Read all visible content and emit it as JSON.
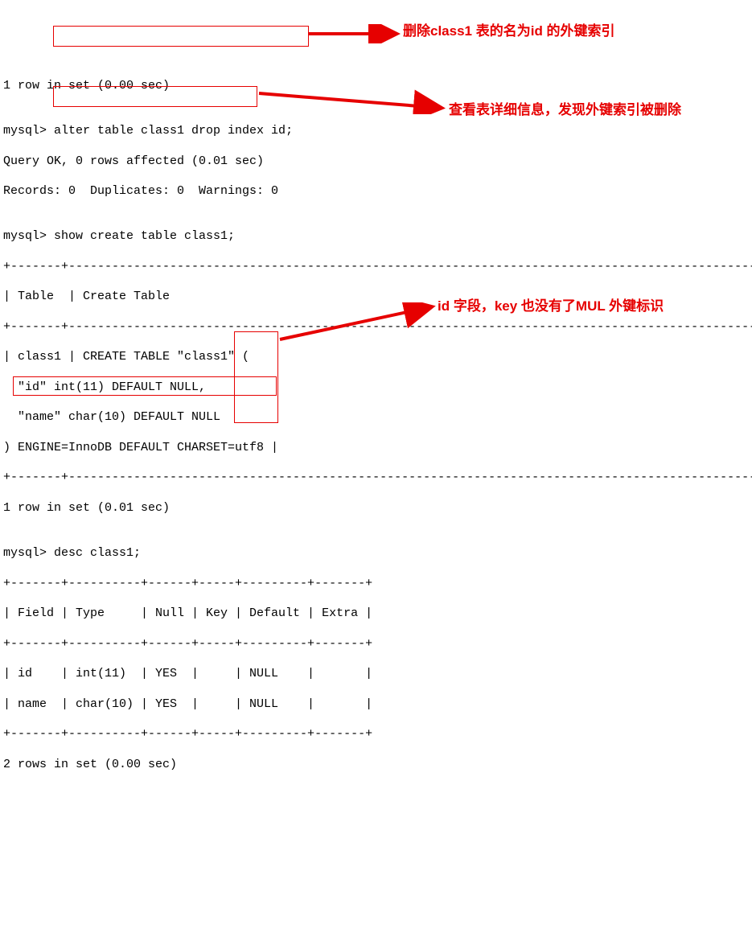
{
  "lines": {
    "l0": "1 row in set (0.00 sec)",
    "l1": "",
    "l2_prompt": "mysql> ",
    "l2_cmd": "alter table class1 drop index id;",
    "l3": "Query OK, 0 rows affected (0.01 sec)",
    "l4": "Records: 0  Duplicates: 0  Warnings: 0",
    "l5": "",
    "l6_prompt": "mysql> ",
    "l6_cmd": "show create table class1;",
    "l7": "+-------+---------------------------------------------------------------------------------------------------------",
    "l8": "| Table  | Create Table",
    "l9": "+-------+---------------------------------------------------------------------------------------------------------",
    "l10": "| class1 | CREATE TABLE \"class1\" (",
    "l11": "  \"id\" int(11) DEFAULT NULL,",
    "l12": "  \"name\" char(10) DEFAULT NULL",
    "l13": ") ENGINE=InnoDB DEFAULT CHARSET=utf8 |",
    "l14": "+-------+---------------------------------------------------------------------------------------------------------",
    "l15": "1 row in set (0.01 sec)",
    "l16": "",
    "l17_prompt": "mysql> ",
    "l17_cmd": "desc class1;",
    "l18": "+-------+----------+------+-----+---------+-------+",
    "l19": "| Field | Type     | Null | Key | Default | Extra |",
    "l20": "+-------+----------+------+-----+---------+-------+",
    "l21": "| id    | int(11)  | YES  |     | NULL    |       |",
    "l22": "| name  | char(10) | YES  |     | NULL    |       |",
    "l23": "+-------+----------+------+-----+---------+-------+",
    "l24": "2 rows in set (0.00 sec)"
  },
  "annotations": {
    "a1": "删除class1 表的名为id 的外键索引",
    "a2": "查看表详细信息，发现外键索引被删除",
    "a3": "id 字段，key 也没有了MUL 外键标识"
  },
  "desc_table": {
    "columns": [
      "Field",
      "Type",
      "Null",
      "Key",
      "Default",
      "Extra"
    ],
    "rows": [
      {
        "Field": "id",
        "Type": "int(11)",
        "Null": "YES",
        "Key": "",
        "Default": "NULL",
        "Extra": ""
      },
      {
        "Field": "name",
        "Type": "char(10)",
        "Null": "YES",
        "Key": "",
        "Default": "NULL",
        "Extra": ""
      }
    ]
  }
}
